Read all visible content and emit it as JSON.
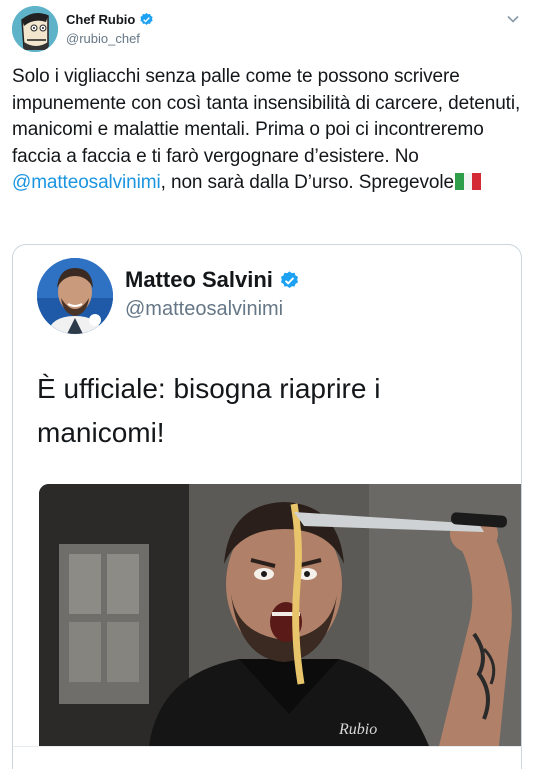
{
  "author": {
    "display_name": "Chef Rubio",
    "handle": "@rubio_chef",
    "avatar_icon": "cartoon-face-avatar",
    "verified": true
  },
  "tweet": {
    "text_before_mention": "Solo i vigliacchi senza palle come te possono scrivere impunemente con così tanta insensibilità di carcere, detenuti, manicomi e malattie mentali. Prima o poi ci incontreremo faccia a faccia e ti farò vergognare d’esistere. No ",
    "mention": "@matteosalvinimi",
    "text_after_mention": ", non sarà dalla D’urso. Spregevole",
    "flag_icon": "italy-flag-emoji"
  },
  "quoted": {
    "display_name": "Matteo Salvini",
    "handle": "@matteosalvinimi",
    "verified": true,
    "text": "È ufficiale: bisogna riaprire i manicomi!",
    "photo_signature": "Rubio"
  },
  "colors": {
    "link": "#1b95e0",
    "verified": "#1da1f2",
    "secondary_text": "#657786",
    "border": "#ccd6dd"
  }
}
